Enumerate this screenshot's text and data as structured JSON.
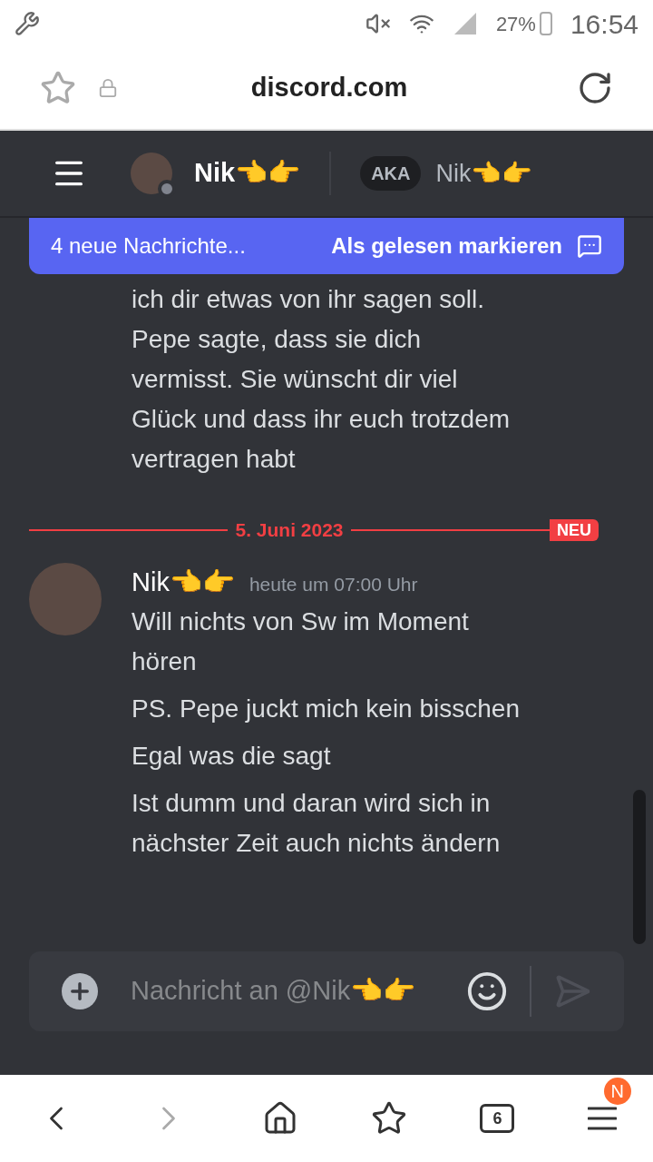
{
  "status_bar": {
    "battery": "27%",
    "time": "16:54"
  },
  "browser": {
    "url": "discord.com"
  },
  "header": {
    "name": "Nik👈👉",
    "aka_badge": "AKA",
    "aka_name": "Nik👈👉"
  },
  "unread_banner": {
    "count_text": "4 neue Nachrichte...",
    "action": "Als gelesen markieren"
  },
  "messages": [
    {
      "kind": "continuation",
      "paragraphs": [
        "ich dir etwas von ihr sagen soll. Pepe sagte, dass sie dich vermisst. Sie wünscht dir viel Glück und dass ihr euch trotzdem vertragen habt"
      ]
    },
    {
      "kind": "divider",
      "date": "5. Juni 2023",
      "badge": "NEU"
    },
    {
      "kind": "message",
      "author": "Nik👈👉",
      "time": "heute um 07:00 Uhr",
      "paragraphs": [
        "Will nichts von Sw im Moment hören",
        "PS. Pepe juckt mich kein bisschen",
        "Egal was die sagt",
        "Ist dumm und daran wird sich in nächster Zeit auch nichts ändern"
      ]
    }
  ],
  "composer": {
    "placeholder": "Nachricht an @Nik👈👉"
  },
  "bottom_nav": {
    "tabs_count": "6",
    "menu_badge": "N"
  }
}
